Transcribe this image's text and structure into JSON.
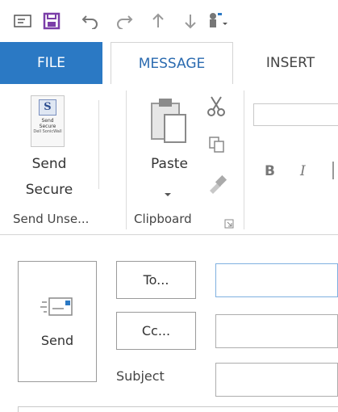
{
  "tabs": {
    "file": "FILE",
    "message": "MESSAGE",
    "insert": "INSERT"
  },
  "ribbon": {
    "send_secure": {
      "icon_letter": "S",
      "icon_line1": "Send",
      "icon_line2": "Secure",
      "icon_line3": "Dell SonicWall",
      "label_line1": "Send",
      "label_line2": "Secure"
    },
    "paste_label": "Paste",
    "bold": "B",
    "italic": "I",
    "group_send": "Send Unse...",
    "group_clipboard": "Clipboard"
  },
  "compose": {
    "send_label": "Send",
    "to_label": "To...",
    "cc_label": "Cc...",
    "subject_label": "Subject",
    "to_value": "",
    "cc_value": "",
    "subject_value": ""
  },
  "colors": {
    "file_tab": "#2b79c4",
    "save_icon": "#7b3ea8",
    "accent_blue": "#2b6bb0"
  }
}
